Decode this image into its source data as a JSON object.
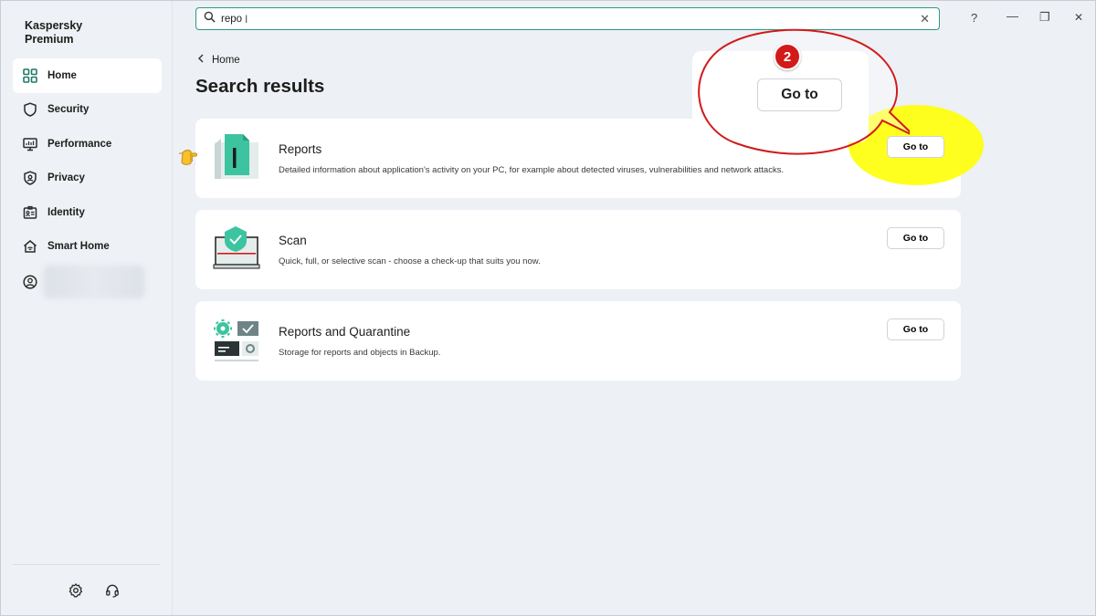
{
  "app": {
    "brand": "Kaspersky\nPremium"
  },
  "sidebar": {
    "items": [
      {
        "label": "Home",
        "icon": "grid-icon",
        "active": true
      },
      {
        "label": "Security",
        "icon": "shield-icon"
      },
      {
        "label": "Performance",
        "icon": "monitor-icon"
      },
      {
        "label": "Privacy",
        "icon": "privacy-shield-icon"
      },
      {
        "label": "Identity",
        "icon": "id-card-icon"
      },
      {
        "label": "Smart Home",
        "icon": "smart-home-icon"
      }
    ],
    "bottom_icons": [
      "settings-gear-icon",
      "headset-support-icon"
    ]
  },
  "search": {
    "value": "repo"
  },
  "window_controls": {
    "help": "?",
    "minimize": "—",
    "restore": "❐",
    "close": "✕"
  },
  "breadcrumb": {
    "back_label": "Home"
  },
  "page": {
    "title": "Search results"
  },
  "results": [
    {
      "title": "Reports",
      "description": "Detailed information about application's activity on your PC, for example about detected viruses, vulnerabilities and network attacks.",
      "button": "Go to",
      "icon": "reports-icon"
    },
    {
      "title": "Scan",
      "description": "Quick, full, or selective scan - choose a check-up that suits you now.",
      "button": "Go to",
      "icon": "scan-icon"
    },
    {
      "title": "Reports and Quarantine",
      "description": "Storage for reports and objects in Backup.",
      "button": "Go to",
      "icon": "reports-quarantine-icon"
    }
  ],
  "annotation": {
    "step_number": "2",
    "callout_button": "Go to",
    "highlight_color": "#ffff00",
    "callout_border_color": "#d21a1a"
  },
  "colors": {
    "accent": "#2c9a83",
    "icon_green": "#3cc4a0",
    "background": "#edf0f5"
  }
}
